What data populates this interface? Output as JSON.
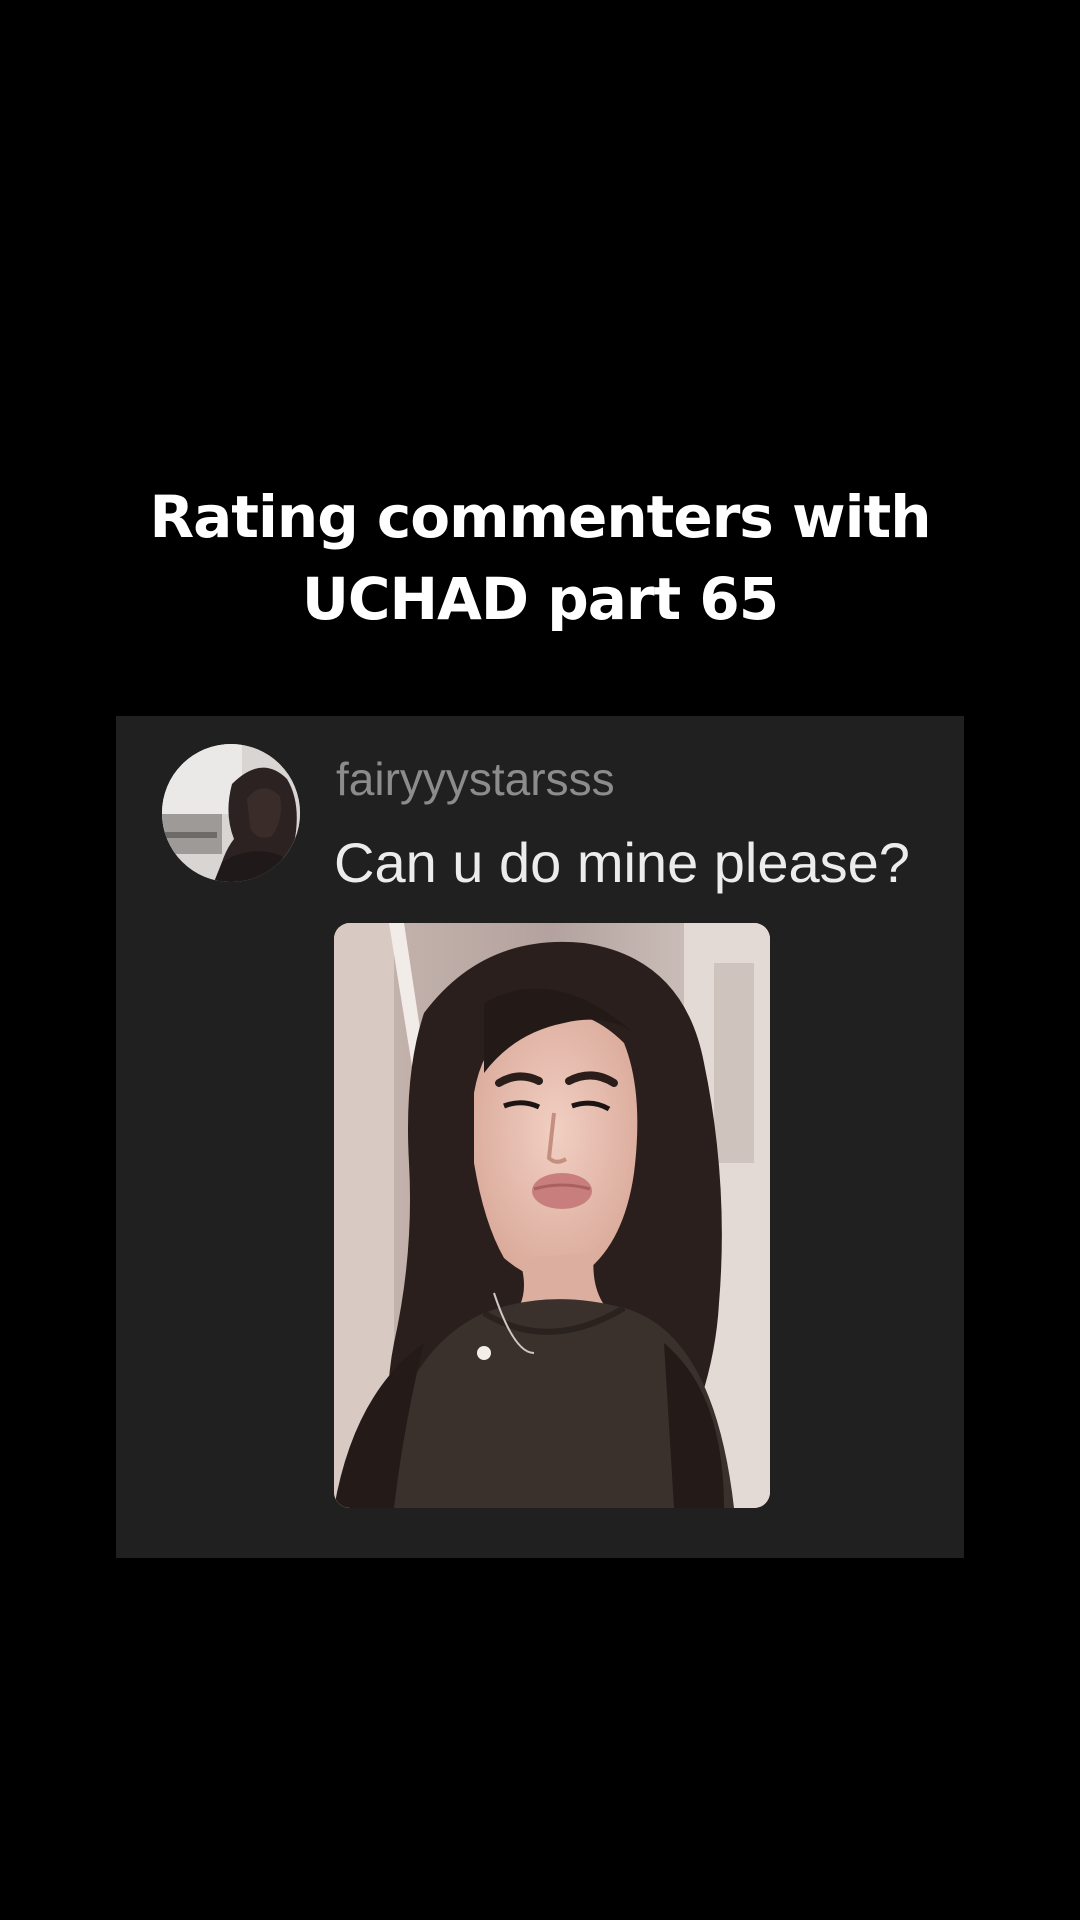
{
  "caption": {
    "line1": "Rating commenters with",
    "line2": "UCHAD part 65"
  },
  "comment": {
    "username": "fairyyystarsss",
    "text": "Can u do mine please?",
    "avatar_icon": "profile-photo",
    "attachment_icon": "selfie-photo"
  },
  "colors": {
    "background": "#000000",
    "card": "#202020",
    "username": "#8c8c8c",
    "comment_text": "#ececec",
    "caption": "#ffffff"
  }
}
